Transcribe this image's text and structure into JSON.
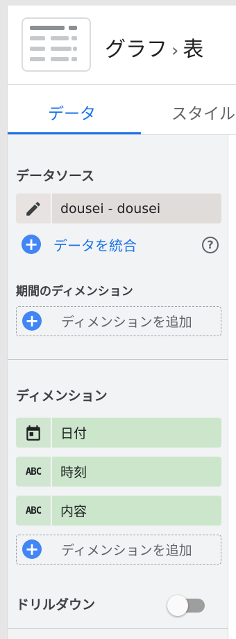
{
  "header": {
    "breadcrumb_parent": "グラフ",
    "breadcrumb_separator": "›",
    "breadcrumb_current": "表",
    "thumbnail_icon": "table-chart-icon"
  },
  "tabs": [
    {
      "label": "データ",
      "active": true
    },
    {
      "label": "スタイル",
      "active": false
    }
  ],
  "data_source": {
    "title": "データソース",
    "name": "dousei - dousei",
    "edit_icon": "pencil-icon",
    "blend_label": "データを統合",
    "help_icon": "help-circle-icon",
    "help_glyph": "?"
  },
  "date_range_dimension": {
    "title": "期間のディメンション",
    "add_label": "ディメンションを追加"
  },
  "dimensions": {
    "title": "ディメンション",
    "items": [
      {
        "label": "日付",
        "type_icon": "calendar-icon",
        "type_text": ""
      },
      {
        "label": "時刻",
        "type_icon": "abc-text-icon",
        "type_text": "ABC"
      },
      {
        "label": "内容",
        "type_icon": "abc-text-icon",
        "type_text": "ABC"
      }
    ],
    "add_label": "ディメンションを追加"
  },
  "drilldown": {
    "label": "ドリルダウン",
    "enabled": false
  },
  "plus_glyph": "+",
  "colors": {
    "accent": "#1a73e8",
    "add_icon": "#4285f4",
    "dimension_chip": "#cce6cc",
    "source_chip": "#e0dcd9"
  }
}
